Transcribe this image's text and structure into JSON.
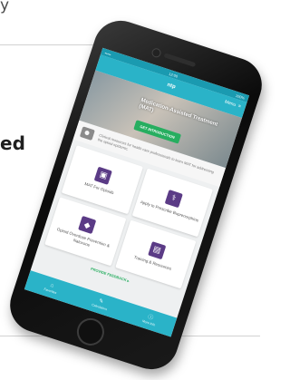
{
  "page": {
    "fragment_top": "y",
    "fragment_mid": "ed"
  },
  "app": {
    "status_left": "••••• ",
    "status_time": "12:00",
    "status_right": "100%",
    "logo": "ntp",
    "menu_label": "Menu",
    "menu_icon": "≡",
    "hero_title": "Medication-Assisted Treatment (MAT)",
    "hero_button": "GET INTRODUCTION",
    "info_text": "Clinical resources for health care professionals to learn MAT for addressing the opioid epidemic.",
    "tiles": [
      {
        "icon": "▣",
        "icon_name": "clipboard-icon",
        "label": "MAT For Opioids"
      },
      {
        "icon": "⚕",
        "icon_name": "pill-icon",
        "label": "Apply to Prescribe Buprenorphine"
      },
      {
        "icon": "◆",
        "icon_name": "gear-icon",
        "label": "Opioid Overdose Prevention & Naloxone"
      },
      {
        "icon": "▤",
        "icon_name": "book-icon",
        "label": "Training & Resources"
      }
    ],
    "feedback": "PROVIDE FEEDBACK ▸",
    "tabs": [
      {
        "icon": "⌂",
        "icon_name": "home-icon",
        "label": "Favorites"
      },
      {
        "icon": "✎",
        "icon_name": "pencil-icon",
        "label": "Calculators"
      },
      {
        "icon": "ⓘ",
        "icon_name": "info-icon",
        "label": "More Info"
      }
    ]
  },
  "colors": {
    "header": "#2ab3c8",
    "status": "#1a9ab0",
    "accent_green": "#27ae60",
    "tile_icon": "#5b3b86"
  }
}
